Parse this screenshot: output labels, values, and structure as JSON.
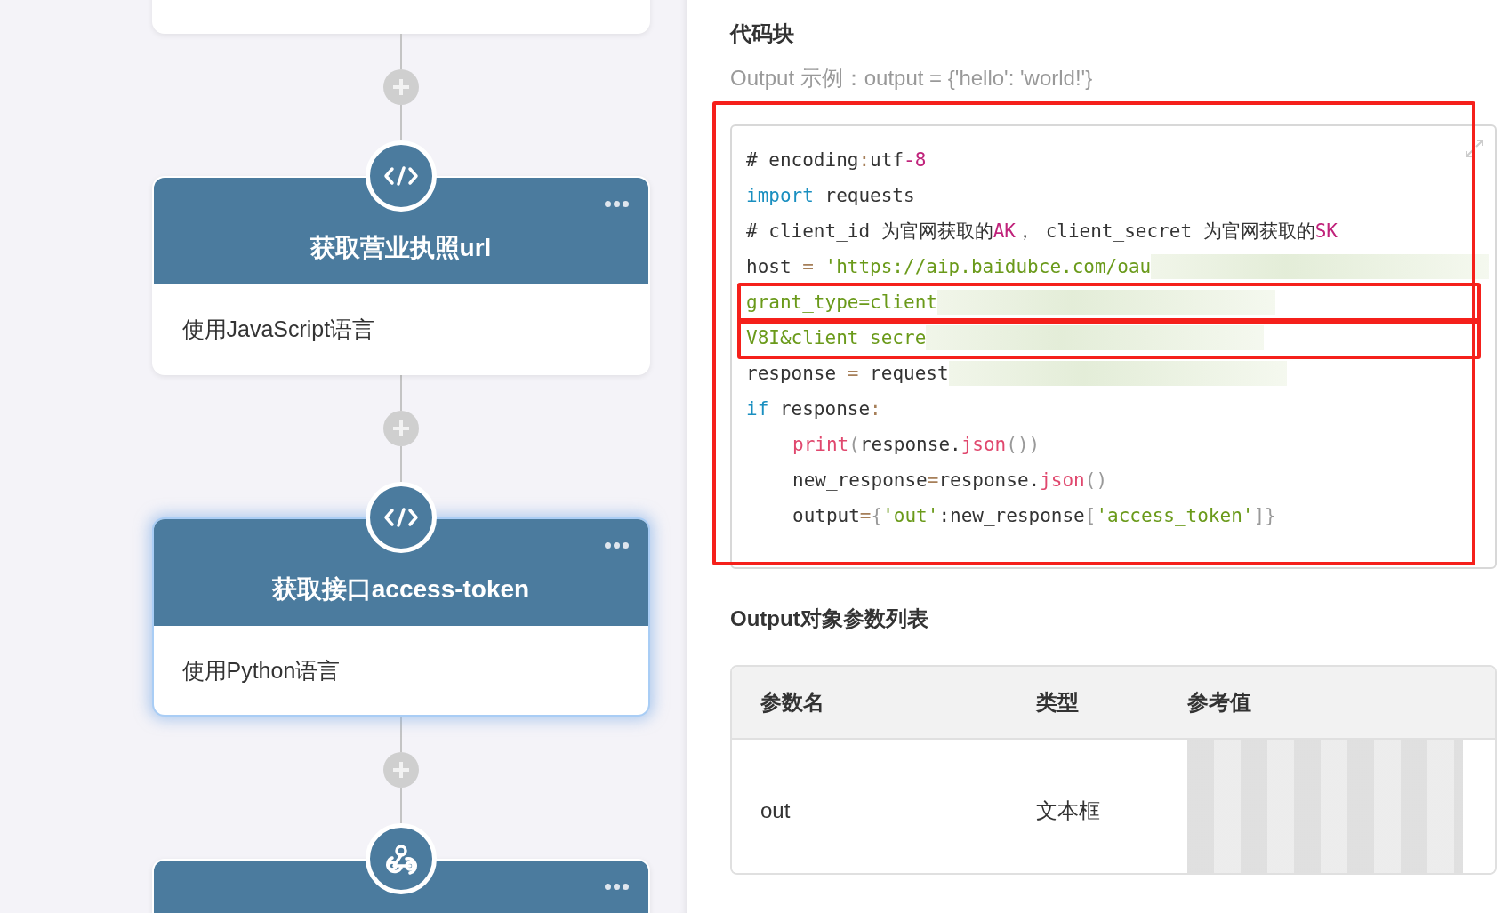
{
  "flow": {
    "nodes": [
      {
        "kind": "code",
        "title": "获取营业执照url",
        "description": "使用JavaScript语言",
        "highlighted": false
      },
      {
        "kind": "code",
        "title": "获取接口access-token",
        "description": "使用Python语言",
        "highlighted": true
      },
      {
        "kind": "webhook"
      }
    ]
  },
  "panel": {
    "title": "代码块",
    "hint": "Output 示例：output = {'hello': 'world!'}",
    "code_lines": [
      {
        "tokens": [
          {
            "t": "# encoding",
            "kind": "plain"
          },
          {
            "t": ":",
            "kind": "op"
          },
          {
            "t": "utf",
            "kind": "plain"
          },
          {
            "t": "-8",
            "kind": "num"
          }
        ]
      },
      {
        "tokens": [
          {
            "t": "import",
            "kind": "kw"
          },
          {
            "t": " requests",
            "kind": "plain"
          }
        ]
      },
      {
        "tokens": [
          {
            "t": "# client_id 为官网获取的",
            "kind": "plain"
          },
          {
            "t": "AK",
            "kind": "num"
          },
          {
            "t": "， client_secret 为官网获取的",
            "kind": "plain"
          },
          {
            "t": "SK",
            "kind": "num"
          }
        ]
      },
      {
        "redacted": true,
        "tokens": [
          {
            "t": "host ",
            "kind": "plain"
          },
          {
            "t": "= ",
            "kind": "op"
          },
          {
            "t": "'https://aip.baidubce.com/oau",
            "kind": "str"
          }
        ]
      },
      {
        "redacted": true,
        "flagged": true,
        "tokens": [
          {
            "t": "grant_type=client",
            "kind": "str"
          }
        ]
      },
      {
        "redacted": true,
        "flagged": true,
        "tokens": [
          {
            "t": "V8I&client_secre",
            "kind": "str"
          }
        ]
      },
      {
        "redacted": true,
        "tokens": [
          {
            "t": "response ",
            "kind": "plain"
          },
          {
            "t": "=",
            "kind": "op"
          },
          {
            "t": " request",
            "kind": "plain"
          }
        ]
      },
      {
        "tokens": [
          {
            "t": "if",
            "kind": "kw"
          },
          {
            "t": " response",
            "kind": "plain"
          },
          {
            "t": ":",
            "kind": "op"
          }
        ]
      },
      {
        "indent": true,
        "tokens": [
          {
            "t": "print",
            "kind": "fn"
          },
          {
            "t": "(",
            "kind": "punc"
          },
          {
            "t": "response.",
            "kind": "plain"
          },
          {
            "t": "json",
            "kind": "fn"
          },
          {
            "t": "())",
            "kind": "punc"
          }
        ]
      },
      {
        "indent": true,
        "tokens": [
          {
            "t": "new_response",
            "kind": "plain"
          },
          {
            "t": "=",
            "kind": "op"
          },
          {
            "t": "response.",
            "kind": "plain"
          },
          {
            "t": "json",
            "kind": "fn"
          },
          {
            "t": "()",
            "kind": "punc"
          }
        ]
      },
      {
        "indent": true,
        "tokens": [
          {
            "t": "output",
            "kind": "plain"
          },
          {
            "t": "=",
            "kind": "op"
          },
          {
            "t": "{",
            "kind": "punc"
          },
          {
            "t": "'out'",
            "kind": "str"
          },
          {
            "t": ":new_response",
            "kind": "plain"
          },
          {
            "t": "[",
            "kind": "punc"
          },
          {
            "t": "'access_token'",
            "kind": "str"
          },
          {
            "t": "]}",
            "kind": "punc"
          }
        ]
      }
    ],
    "table_title": "Output对象参数列表",
    "table": {
      "columns": [
        "参数名",
        "类型",
        "参考值"
      ],
      "rows": [
        {
          "cells": [
            "out",
            "文本框"
          ],
          "redacted": true
        }
      ]
    }
  }
}
